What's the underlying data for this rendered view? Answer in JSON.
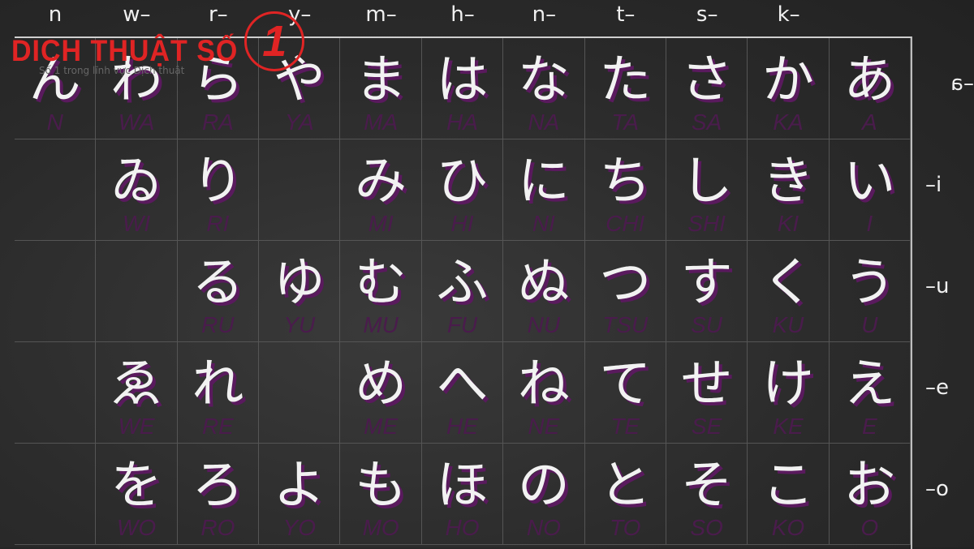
{
  "logo": {
    "text": "DICH THUẬT SỐ",
    "number": "1",
    "tagline": "Số 1 trong lĩnh vực Dịch thuật",
    "color": "#e02424"
  },
  "column_headers": [
    "n",
    "w–",
    "r–",
    "y–",
    "m–",
    "h–",
    "n–",
    "t–",
    "s–",
    "k–",
    ""
  ],
  "row_headers": [
    "–a",
    "–i",
    "–u",
    "–e",
    "–o"
  ],
  "colors": {
    "kana": "#f2f2f2",
    "kana_shadow": "#5a1a5e",
    "romaji": "#4a1c4c",
    "background": "#2b2b2b"
  },
  "rows": [
    [
      {
        "kana": "ん",
        "romaji": "N"
      },
      {
        "kana": "わ",
        "romaji": "WA"
      },
      {
        "kana": "ら",
        "romaji": "RA"
      },
      {
        "kana": "や",
        "romaji": "YA"
      },
      {
        "kana": "ま",
        "romaji": "MA"
      },
      {
        "kana": "は",
        "romaji": "HA"
      },
      {
        "kana": "な",
        "romaji": "NA"
      },
      {
        "kana": "た",
        "romaji": "TA"
      },
      {
        "kana": "さ",
        "romaji": "SA"
      },
      {
        "kana": "か",
        "romaji": "KA"
      },
      {
        "kana": "あ",
        "romaji": "A"
      }
    ],
    [
      null,
      {
        "kana": "ゐ",
        "romaji": "WI"
      },
      {
        "kana": "り",
        "romaji": "RI"
      },
      null,
      {
        "kana": "み",
        "romaji": "MI"
      },
      {
        "kana": "ひ",
        "romaji": "HI"
      },
      {
        "kana": "に",
        "romaji": "NI"
      },
      {
        "kana": "ち",
        "romaji": "CHI"
      },
      {
        "kana": "し",
        "romaji": "SHI"
      },
      {
        "kana": "き",
        "romaji": "KI"
      },
      {
        "kana": "い",
        "romaji": "I"
      }
    ],
    [
      null,
      null,
      {
        "kana": "る",
        "romaji": "RU"
      },
      {
        "kana": "ゆ",
        "romaji": "YU"
      },
      {
        "kana": "む",
        "romaji": "MU"
      },
      {
        "kana": "ふ",
        "romaji": "FU"
      },
      {
        "kana": "ぬ",
        "romaji": "NU"
      },
      {
        "kana": "つ",
        "romaji": "TSU"
      },
      {
        "kana": "す",
        "romaji": "SU"
      },
      {
        "kana": "く",
        "romaji": "KU"
      },
      {
        "kana": "う",
        "romaji": "U"
      }
    ],
    [
      null,
      {
        "kana": "ゑ",
        "romaji": "WE"
      },
      {
        "kana": "れ",
        "romaji": "RE"
      },
      null,
      {
        "kana": "め",
        "romaji": "ME"
      },
      {
        "kana": "へ",
        "romaji": "HE"
      },
      {
        "kana": "ね",
        "romaji": "NE"
      },
      {
        "kana": "て",
        "romaji": "TE"
      },
      {
        "kana": "せ",
        "romaji": "SE"
      },
      {
        "kana": "け",
        "romaji": "KE"
      },
      {
        "kana": "え",
        "romaji": "E"
      }
    ],
    [
      null,
      {
        "kana": "を",
        "romaji": "WO"
      },
      {
        "kana": "ろ",
        "romaji": "RO"
      },
      {
        "kana": "よ",
        "romaji": "YO"
      },
      {
        "kana": "も",
        "romaji": "MO"
      },
      {
        "kana": "ほ",
        "romaji": "HO"
      },
      {
        "kana": "の",
        "romaji": "NO"
      },
      {
        "kana": "と",
        "romaji": "TO"
      },
      {
        "kana": "そ",
        "romaji": "SO"
      },
      {
        "kana": "こ",
        "romaji": "KO"
      },
      {
        "kana": "お",
        "romaji": "O"
      }
    ]
  ]
}
